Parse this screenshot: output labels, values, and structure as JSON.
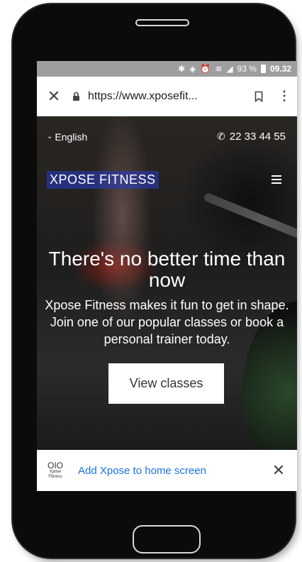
{
  "status_bar": {
    "battery_percent": "93 %",
    "time": "09.32",
    "icons": [
      "bluetooth-icon",
      "vibrate-icon",
      "alarm-icon",
      "wifi-icon",
      "signal-icon",
      "battery-icon"
    ]
  },
  "browser": {
    "url": "https://www.xposefit...",
    "close_icon": "close-icon",
    "lock_icon": "lock-icon",
    "bookmark_icon": "bookmark-icon",
    "menu_icon": "more-vert-icon"
  },
  "page": {
    "language": "English",
    "phone": "22 33 44 55",
    "brand": "XPOSE FITNESS",
    "headline": "There's no better time than now",
    "subtext": "Xpose Fitness makes it fun to get in shape. Join one of our popular classes or book a personal trainer today.",
    "cta_label": "View classes"
  },
  "add_to_home": {
    "logo_text": "Xpose Fitness",
    "label": "Add Xpose to home screen"
  }
}
